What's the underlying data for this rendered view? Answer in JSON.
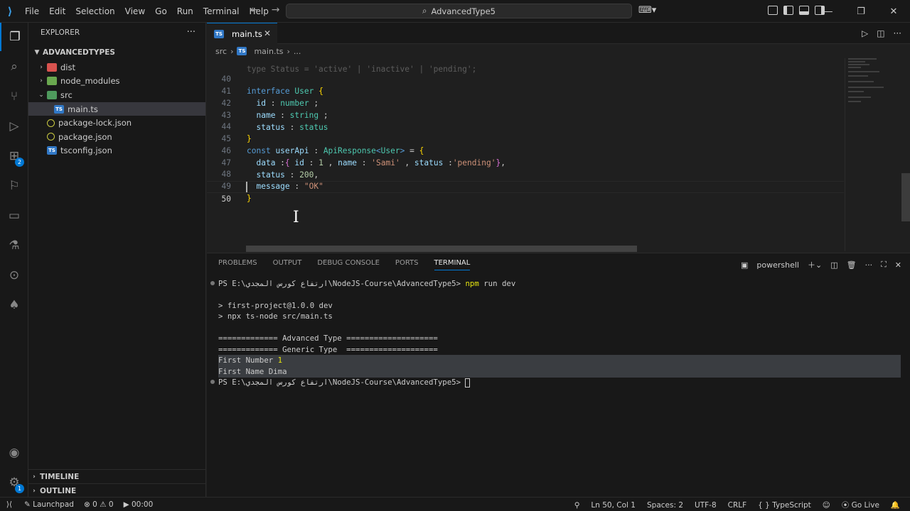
{
  "menu": [
    "File",
    "Edit",
    "Selection",
    "View",
    "Go",
    "Run",
    "Terminal",
    "Help"
  ],
  "search": {
    "text": "AdvancedType5"
  },
  "explorer": {
    "title": "EXPLORER",
    "folder": "ADVANCEDTYPES",
    "items": [
      {
        "label": "dist"
      },
      {
        "label": "node_modules"
      },
      {
        "label": "src"
      },
      {
        "label": "main.ts"
      },
      {
        "label": "package-lock.json"
      },
      {
        "label": "package.json"
      },
      {
        "label": "tsconfig.json"
      }
    ],
    "timeline": "TIMELINE",
    "outline": "OUTLINE"
  },
  "activity_badges": {
    "extensions": "2",
    "settings": "1"
  },
  "tab": {
    "label": "main.ts"
  },
  "breadcrumb": {
    "folder": "src",
    "file": "main.ts",
    "more": "..."
  },
  "code": {
    "line_numbers": [
      "40",
      "41",
      "42",
      "43",
      "44",
      "45",
      "46",
      "47",
      "48",
      "49",
      "50"
    ],
    "hidden_top": "type Status = 'active' | 'inactive' | 'pending';"
  },
  "panel": {
    "tabs": [
      "PROBLEMS",
      "OUTPUT",
      "DEBUG CONSOLE",
      "PORTS",
      "TERMINAL"
    ],
    "shell": "powershell"
  },
  "terminal": {
    "prompt1": "PS E:\\ارتفاع كورس المجدي\\NodeJS-Course\\AdvancedType5> ",
    "cmd1": "npm",
    "cmd1_rest": " run dev",
    "out1": "> first-project@1.0.0 dev",
    "out2": "> npx ts-node src/main.ts",
    "out3": "============= Advanced Type ====================",
    "out4": "============= Generic Type  ====================",
    "out5_label": "First Number ",
    "out5_value": "1",
    "out6": "First Name Dima",
    "prompt2": "PS E:\\ارتفاع كورس المجدي\\NodeJS-Course\\AdvancedType5> "
  },
  "status": {
    "launchpad": "Launchpad",
    "errors": "0",
    "warnings": "0",
    "time": "00:00",
    "position": "Ln 50, Col 1",
    "spaces": "Spaces: 2",
    "encoding": "UTF-8",
    "eol": "CRLF",
    "language": "TypeScript",
    "golive": "Go Live"
  }
}
